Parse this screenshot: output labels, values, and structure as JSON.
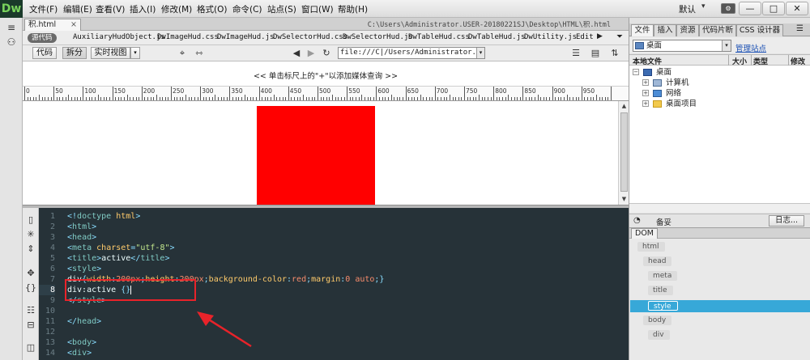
{
  "app": {
    "logo": "Dw"
  },
  "menu": [
    "文件(F)",
    "编辑(E)",
    "查看(V)",
    "插入(I)",
    "修改(M)",
    "格式(O)",
    "命令(C)",
    "站点(S)",
    "窗口(W)",
    "帮助(H)"
  ],
  "layout_mode": "默认",
  "window_buttons": [
    "—",
    "□",
    "✕"
  ],
  "document": {
    "tab_label": "积.html",
    "tab_close": "×",
    "path": "C:\\Users\\Administrator.USER-20180221SJ\\Desktop\\HTML\\积.html",
    "source_chip": "源代码",
    "related_files": [
      "AuxiliaryHudObject.js",
      "DwImageHud.css",
      "DwImageHud.js",
      "DwSelectorHud.css",
      "DwSelectorHud.js",
      "DwTableHud.css",
      "DwTableHud.js",
      "DwUtility.js",
      "Edit"
    ],
    "view_buttons": {
      "code": "代码",
      "split": "拆分",
      "live": "实时视图"
    },
    "url": "file:///C|/Users/Administrator.USER-20",
    "design_hint": "<< 单击标尺上的\"+\"以添加媒体查询 >>",
    "ruler_labels": [
      "0",
      "50",
      "100",
      "150",
      "200",
      "250",
      "300",
      "350",
      "400",
      "450",
      "500",
      "550",
      "600",
      "650",
      "700",
      "750",
      "800",
      "850",
      "900",
      "950"
    ],
    "red_box_color": "#ff0000"
  },
  "code": {
    "lines": [
      {
        "num": "1",
        "parts": [
          [
            "t-punc",
            "<!"
          ],
          [
            "t-tag",
            "doctype"
          ],
          [
            "t-txt",
            " "
          ],
          [
            "t-attr",
            "html"
          ],
          [
            "t-punc",
            ">"
          ]
        ]
      },
      {
        "num": "2",
        "parts": [
          [
            "t-punc",
            "<"
          ],
          [
            "t-tag",
            "html"
          ],
          [
            "t-punc",
            ">"
          ]
        ]
      },
      {
        "num": "3",
        "parts": [
          [
            "t-punc",
            "<"
          ],
          [
            "t-tag",
            "head"
          ],
          [
            "t-punc",
            ">"
          ]
        ]
      },
      {
        "num": "4",
        "parts": [
          [
            "t-punc",
            "<"
          ],
          [
            "t-tag",
            "meta"
          ],
          [
            "t-txt",
            " "
          ],
          [
            "t-attr",
            "charset"
          ],
          [
            "t-punc",
            "="
          ],
          [
            "t-str",
            "\"utf-8\""
          ],
          [
            "t-punc",
            ">"
          ]
        ]
      },
      {
        "num": "5",
        "parts": [
          [
            "t-punc",
            "<"
          ],
          [
            "t-tag",
            "title"
          ],
          [
            "t-punc",
            ">"
          ],
          [
            "t-txt",
            "active"
          ],
          [
            "t-punc",
            "</"
          ],
          [
            "t-tag",
            "title"
          ],
          [
            "t-punc",
            ">"
          ]
        ]
      },
      {
        "num": "6",
        "parts": [
          [
            "t-punc",
            "<"
          ],
          [
            "t-tag",
            "style"
          ],
          [
            "t-punc",
            ">"
          ]
        ]
      },
      {
        "num": "7",
        "parts": [
          [
            "t-sel",
            "div"
          ],
          [
            "t-punc",
            "{"
          ],
          [
            "t-prop",
            "width"
          ],
          [
            "t-punc",
            ":"
          ],
          [
            "t-val",
            "200px"
          ],
          [
            "t-punc",
            ";"
          ],
          [
            "t-prop",
            "height"
          ],
          [
            "t-punc",
            ":"
          ],
          [
            "t-val",
            "200px"
          ],
          [
            "t-punc",
            ";"
          ],
          [
            "t-prop",
            "background-color"
          ],
          [
            "t-punc",
            ":"
          ],
          [
            "t-val",
            "red"
          ],
          [
            "t-punc",
            ";"
          ],
          [
            "t-prop",
            "margin"
          ],
          [
            "t-punc",
            ":"
          ],
          [
            "t-val",
            "0 auto"
          ],
          [
            "t-punc",
            ";}"
          ]
        ]
      },
      {
        "num": "8",
        "parts": [
          [
            "t-sel",
            "div:active "
          ],
          [
            "t-punc",
            "{}"
          ]
        ]
      },
      {
        "num": "9",
        "parts": [
          [
            "t-punc",
            "</"
          ],
          [
            "t-tag",
            "style"
          ],
          [
            "t-punc",
            ">"
          ]
        ]
      },
      {
        "num": "10",
        "parts": []
      },
      {
        "num": "11",
        "parts": [
          [
            "t-punc",
            "</"
          ],
          [
            "t-tag",
            "head"
          ],
          [
            "t-punc",
            ">"
          ]
        ]
      },
      {
        "num": "12",
        "parts": []
      },
      {
        "num": "13",
        "parts": [
          [
            "t-punc",
            "<"
          ],
          [
            "t-tag",
            "body"
          ],
          [
            "t-punc",
            ">"
          ]
        ]
      },
      {
        "num": "14",
        "parts": [
          [
            "t-punc",
            "<"
          ],
          [
            "t-tag",
            "div"
          ],
          [
            "t-punc",
            ">"
          ]
        ]
      }
    ],
    "current_line": "8"
  },
  "right_panel": {
    "tabs": [
      "文件",
      "插入",
      "资源",
      "代码片断",
      "CSS 设计器"
    ],
    "site": "桌面",
    "manage_link": "管理站点",
    "file_columns": [
      "本地文件",
      "大小",
      "类型",
      "修改"
    ],
    "tree": [
      {
        "label": "桌面",
        "icon": "desktop-icon",
        "exp": "−"
      },
      {
        "label": "计算机",
        "icon": "computer-icon",
        "exp": "+"
      },
      {
        "label": "网络",
        "icon": "network-icon",
        "exp": "+"
      },
      {
        "label": "桌面项目",
        "icon": "folder-icon",
        "exp": "+"
      }
    ],
    "status_label": "备妥",
    "log_button": "日志...",
    "dom_tab": "DOM",
    "dom_nodes": [
      "html",
      "head",
      "meta",
      "title",
      "style",
      "body",
      "div"
    ],
    "dom_selected": "style"
  }
}
